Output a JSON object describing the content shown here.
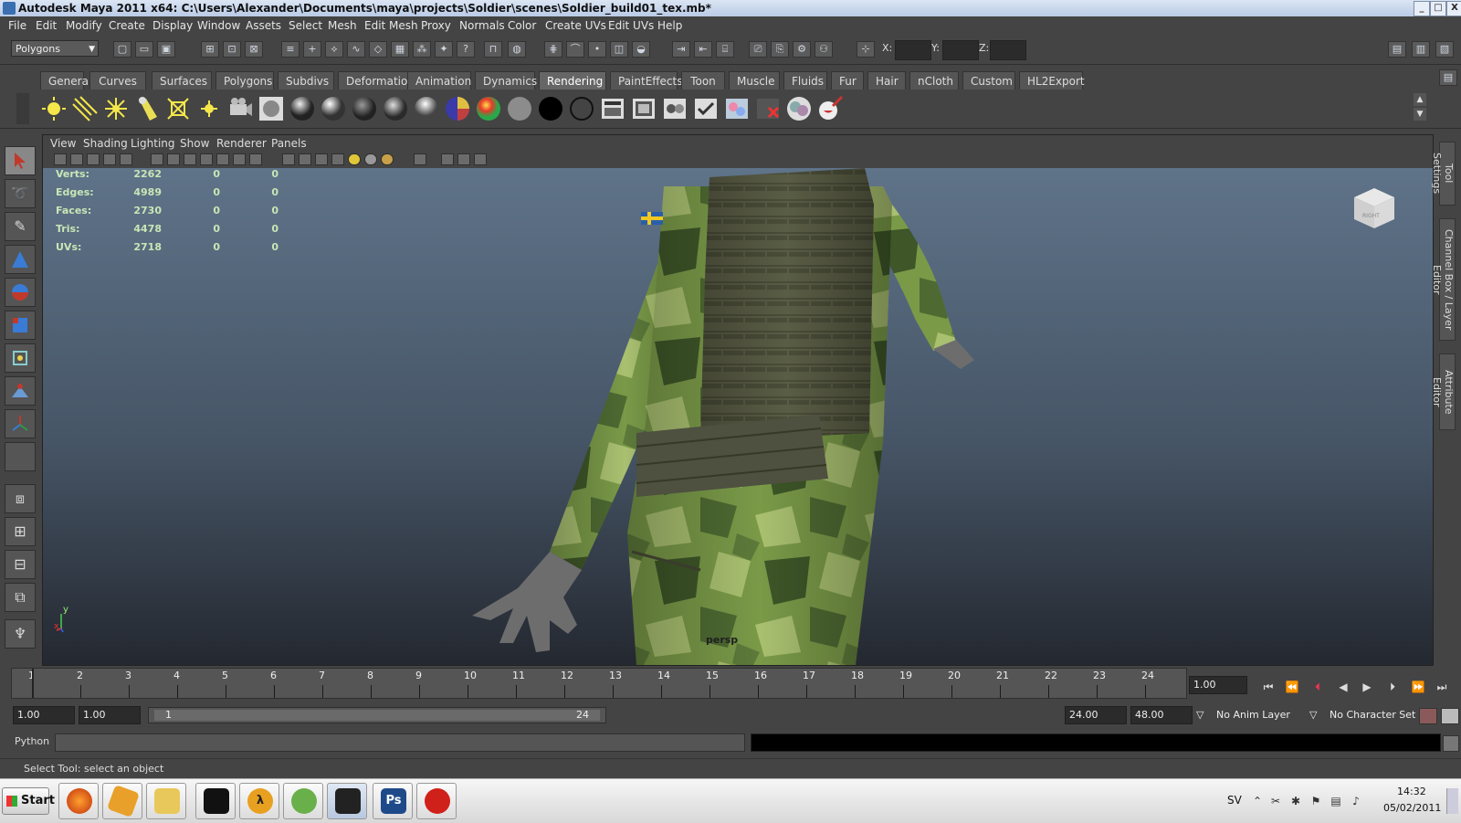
{
  "window": {
    "title": "Autodesk Maya 2011 x64: C:\\Users\\Alexander\\Documents\\maya\\projects\\Soldier\\scenes\\Soldier_build01_tex.mb*",
    "controls": [
      "_",
      "□",
      "X"
    ]
  },
  "menubar": [
    "File",
    "Edit",
    "Modify",
    "Create",
    "Display",
    "Window",
    "Assets",
    "Select",
    "Mesh",
    "Edit Mesh",
    "Proxy",
    "Normals",
    "Color",
    "Create UVs",
    "Edit UVs",
    "Help"
  ],
  "statusline": {
    "mode": "Polygons",
    "x_label": "X:",
    "y_label": "Y:",
    "z_label": "Z:"
  },
  "shelf_tabs": [
    "General",
    "Curves",
    "Surfaces",
    "Polygons",
    "Subdivs",
    "Deformation",
    "Animation",
    "Dynamics",
    "Rendering",
    "PaintEffects",
    "Toon",
    "Muscle",
    "Fluids",
    "Fur",
    "Hair",
    "nCloth",
    "Custom",
    "HL2Export"
  ],
  "active_shelf_tab": "Rendering",
  "panel_menu": [
    "View",
    "Shading",
    "Lighting",
    "Show",
    "Renderer",
    "Panels"
  ],
  "hud": {
    "rows": [
      {
        "label": "Verts:",
        "v1": "2262",
        "v2": "0",
        "v3": "0"
      },
      {
        "label": "Edges:",
        "v1": "4989",
        "v2": "0",
        "v3": "0"
      },
      {
        "label": "Faces:",
        "v1": "2730",
        "v2": "0",
        "v3": "0"
      },
      {
        "label": "Tris:",
        "v1": "4478",
        "v2": "0",
        "v3": "0"
      },
      {
        "label": "UVs:",
        "v1": "2718",
        "v2": "0",
        "v3": "0"
      }
    ]
  },
  "viewport": {
    "camera_label": "persp",
    "view_cube_label": "RIGHT",
    "axis_y": "y",
    "axis_x": "x"
  },
  "side_tabs": [
    "Tool Settings",
    "Channel Box / Layer Editor",
    "Attribute Editor"
  ],
  "timeline": {
    "frames": [
      "1",
      "2",
      "3",
      "4",
      "5",
      "6",
      "7",
      "8",
      "9",
      "10",
      "11",
      "12",
      "13",
      "14",
      "15",
      "16",
      "17",
      "18",
      "19",
      "20",
      "21",
      "22",
      "23",
      "24"
    ],
    "current_frame": "1.00"
  },
  "range": {
    "start": "1.00",
    "playback_start": "1.00",
    "slider_start": "1",
    "slider_end": "24",
    "playback_end": "24.00",
    "end": "48.00",
    "anim_layer": "No Anim Layer",
    "character_set": "No Character Set"
  },
  "command": {
    "language": "Python"
  },
  "helpline": "Select Tool: select an object",
  "taskbar": {
    "start": "Start",
    "language": "SV",
    "time": "14:32",
    "date": "05/02/2011"
  },
  "colors": {
    "camo_light": "#8aa85a",
    "camo_dark": "#4e6a3a",
    "vest": "#5d6048",
    "skin_gray": "#6d6d6d",
    "hud_text": "#c8e6b5"
  }
}
